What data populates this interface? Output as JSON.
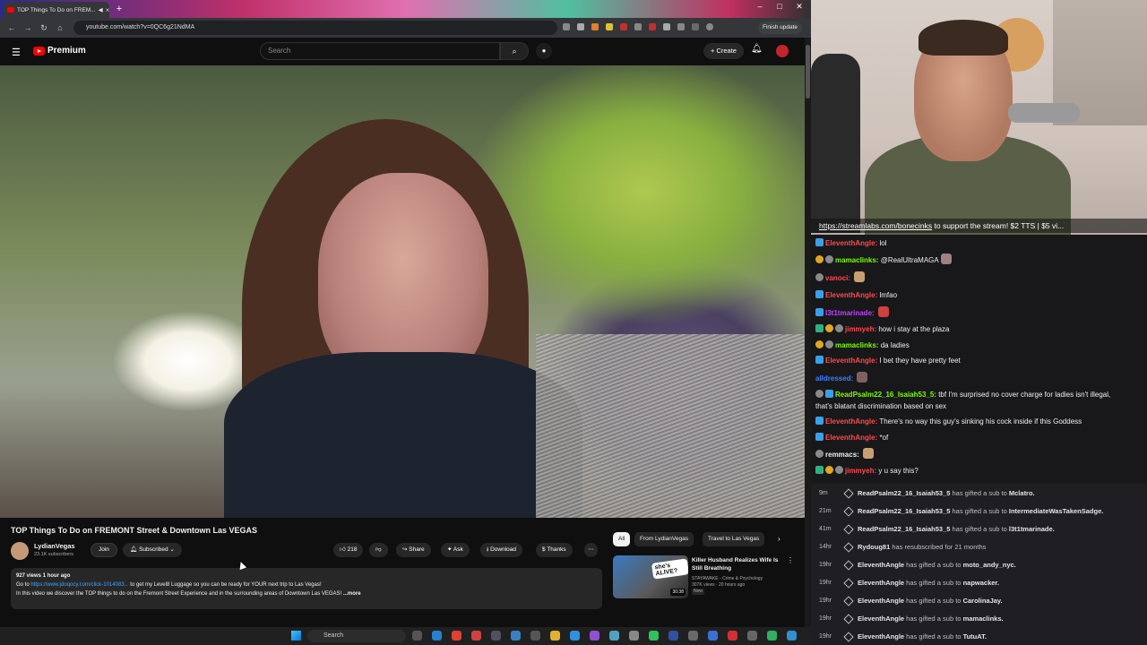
{
  "browser": {
    "tab_title": "TOP Things To Do on FREM...",
    "url": "youtube.com/watch?v=0QC6g21NdMA",
    "finish_update": "Finish update"
  },
  "youtube": {
    "logo_text": "Premium",
    "search_placeholder": "Search",
    "create_label": "Create"
  },
  "video": {
    "title": "TOP Things To Do on FREMONT Street & Downtown Las VEGAS",
    "channel": "LydianVegas",
    "subscribers": "23.1K subscribers",
    "join_label": "Join",
    "subscribed_label": "Subscribed",
    "likes": "218",
    "share_label": "Share",
    "ask_label": "Ask",
    "download_label": "Download",
    "thanks_label": "Thanks",
    "views_time": "927 views  1 hour ago",
    "desc_prefix": "Go to ",
    "desc_link": "https://www.jdoqocy.com/click-1014083...",
    "desc_rest": " to get my Level8 Luggage so you can be ready for YOUR next trip to Las Vegas!",
    "desc_line2": "In this video we discover the TOP things to do on the Fremont Street Experience and in the surrounding areas of Downtown Las VEGAS! ",
    "desc_more": "...more"
  },
  "related": {
    "chips": [
      "All",
      "From LydianVegas",
      "Travel to Las Vegas"
    ],
    "item": {
      "title": "Killer Husband Realizes Wife Is Still Breathing",
      "channel": "STAYAWAKE - Crime & Psychology",
      "meta": "307K views · 20 hours ago",
      "badge": "New",
      "duration": "30:38",
      "thumb_text": "she's ALIVE?"
    }
  },
  "stream": {
    "marquee_link": "https://streamlabs.com/bonecinks",
    "marquee_text": " to support the stream! $2 TTS | $5 vi..."
  },
  "chat": [
    {
      "user": "EleventhAngle",
      "color": "#ff4a4a",
      "text": "lol",
      "badges": [
        "blue"
      ]
    },
    {
      "user": "mamaclinks",
      "color": "#7cfc00",
      "text": "@RealUltraMAGA",
      "badges": [
        "gold",
        "grey"
      ],
      "emote": "#a08080"
    },
    {
      "user": "vanoci:",
      "color": "#ff4a4a",
      "text": "",
      "badges": [
        "grey"
      ],
      "emote": "#c8a070"
    },
    {
      "user": "EleventhAngle",
      "color": "#ff4a4a",
      "text": "lmfao",
      "badges": [
        "blue"
      ]
    },
    {
      "user": "l3t1tmarinade",
      "color": "#c040ff",
      "text": "",
      "badges": [
        "blue"
      ],
      "emote": "#d04040"
    },
    {
      "user": "jimmyeh",
      "color": "#ff4a4a",
      "text": "how i stay at the plaza",
      "badges": [
        "green",
        "gold",
        "grey"
      ]
    },
    {
      "user": "mamaclinks",
      "color": "#7cfc00",
      "text": "da ladies",
      "badges": [
        "gold",
        "grey"
      ]
    },
    {
      "user": "EleventhAngle",
      "color": "#ff4a4a",
      "text": "I bet they have pretty feet",
      "badges": [
        "blue"
      ]
    },
    {
      "user": "alldressed:",
      "color": "#3a80ff",
      "text": "",
      "badges": [],
      "emote": "#806060"
    },
    {
      "user": "ReadPsalm22_16_Isaiah53_5",
      "color": "#7cfc00",
      "text": "tbf I'm surprised no cover charge for ladies isn't illegal,",
      "text2": "that's blatant discrimination based on sex",
      "badges": [
        "grey",
        "blue"
      ]
    },
    {
      "user": "EleventhAngle",
      "color": "#ff4a4a",
      "text": "There's no way this guy's sinking his cock inside if this Goddess",
      "badges": [
        "blue"
      ]
    },
    {
      "user": "EleventhAngle",
      "color": "#ff4a4a",
      "text": "*of",
      "badges": [
        "blue"
      ]
    },
    {
      "user": "remmacs:",
      "color": "#efeff1",
      "text": "",
      "badges": [
        "grey"
      ],
      "emote": "#c8a070"
    },
    {
      "user": "jimmyeh",
      "color": "#ff4a4a",
      "text": "y u say this?",
      "badges": [
        "green",
        "gold",
        "grey"
      ]
    }
  ],
  "events": [
    {
      "time": "9m",
      "user": "ReadPsalm22_16_Isaiah53_5",
      "action": " has gifted a sub to ",
      "target": "Mclatro."
    },
    {
      "time": "21m",
      "user": "ReadPsalm22_16_Isaiah53_5",
      "action": " has gifted a sub to ",
      "target": "IntermediateWasTakenSadge."
    },
    {
      "time": "41m",
      "user": "ReadPsalm22_16_Isaiah53_5",
      "action": " has gifted a sub to ",
      "target": "l3t1tmarinade."
    },
    {
      "time": "14hr",
      "user": "Rydoug81",
      "action": " has resubscribed for 21 months",
      "target": ""
    },
    {
      "time": "19hr",
      "user": "EleventhAngle",
      "action": " has gifted a sub to ",
      "target": "moto_andy_nyc."
    },
    {
      "time": "19hr",
      "user": "EleventhAngle",
      "action": " has gifted a sub to ",
      "target": "napwacker."
    },
    {
      "time": "19hr",
      "user": "EleventhAngle",
      "action": " has gifted a sub to ",
      "target": "CarolinaJay."
    },
    {
      "time": "19hr",
      "user": "EleventhAngle",
      "action": " has gifted a sub to ",
      "target": "mamaclinks."
    },
    {
      "time": "19hr",
      "user": "EleventhAngle",
      "action": " has gifted a sub to ",
      "target": "TutuAT."
    }
  ],
  "taskbar": {
    "search_label": "Search"
  }
}
